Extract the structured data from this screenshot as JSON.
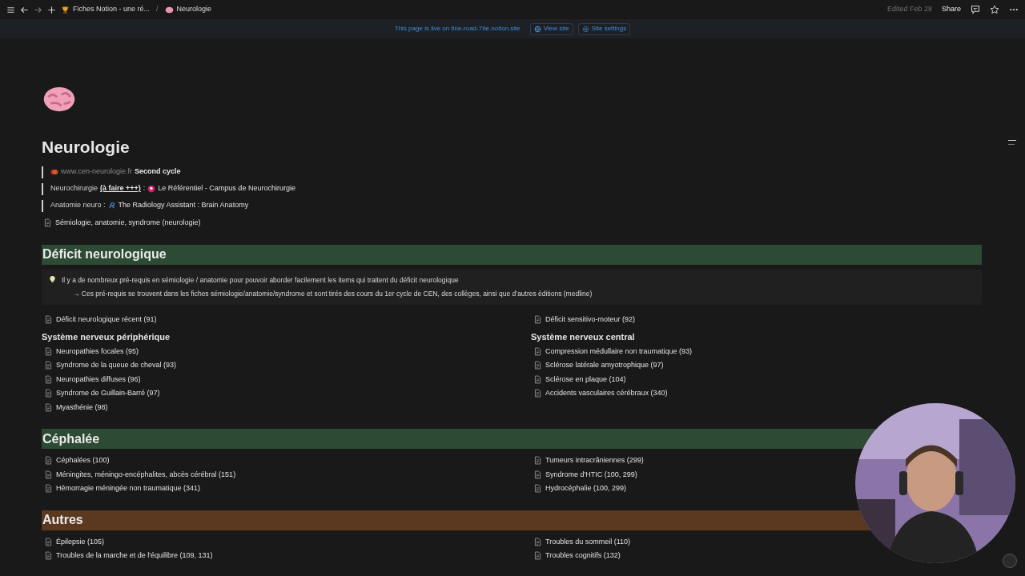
{
  "topbar": {
    "breadcrumbs": [
      {
        "text": "Fiches Notion - une ré..."
      },
      {
        "text": "Neurologie"
      }
    ],
    "separator": "/",
    "edited": "Edited Feb 28",
    "share": "Share"
  },
  "banner": {
    "text": "This page is live on fine-road-79e.notion.site",
    "buttons": [
      {
        "label": "View site"
      },
      {
        "label": "Site settings"
      }
    ]
  },
  "page": {
    "title": "Neurologie",
    "quotes": [
      {
        "parts": [
          {
            "kind": "site-link",
            "text": "www.cen-neurologie.fr"
          },
          {
            "kind": "strong",
            "text": "Second cycle"
          }
        ]
      },
      {
        "parts": [
          {
            "kind": "text",
            "text": "Neurochirurgie"
          },
          {
            "kind": "underline",
            "text": "(à faire +++)"
          },
          {
            "kind": "text",
            "text": ":"
          },
          {
            "kind": "mention",
            "text": "Le Référentiel - Campus de Neurochirurgie"
          }
        ]
      },
      {
        "parts": [
          {
            "kind": "text",
            "text": "Anatomie neuro :"
          },
          {
            "kind": "mention",
            "text": "The Radiology Assistant : Brain Anatomy"
          }
        ]
      }
    ],
    "links": [
      "Sémiologie, anatomie, syndrome (neurologie)"
    ],
    "sections": [
      {
        "title": "Déficit neurologique",
        "color": "#2d4a35",
        "callout": [
          "Il y a de nombreux pré-requis en sémiologie / anatomie pour pouvoir aborder facilement les items qui traitent du déficit neurologique",
          "→ Ces pré-requis se trouvent dans les fiches sémiologie/anatomie/syndrome et sont tirés des cours du 1er cycle de CEN, des collèges, ainsi que d’autres éditions (medline)"
        ],
        "columns": [
          [
            {
              "kind": "page",
              "text": "Déficit neurologique récent (91)"
            },
            {
              "kind": "subheading",
              "text": "Système nerveux périphérique"
            },
            {
              "kind": "page",
              "text": "Neuropathies focales (95)"
            },
            {
              "kind": "page",
              "text": "Syndrome de la queue de cheval (93)"
            },
            {
              "kind": "page",
              "text": "Neuropathies diffuses (96)"
            },
            {
              "kind": "page",
              "text": "Syndrome de Guillain-Barré (97)"
            },
            {
              "kind": "page",
              "text": "Myasthénie (98)"
            }
          ],
          [
            {
              "kind": "page",
              "text": "Déficit sensitivo-moteur (92)"
            },
            {
              "kind": "subheading",
              "text": "Système nerveux central"
            },
            {
              "kind": "page",
              "text": "Compression médullaire non traumatique (93)"
            },
            {
              "kind": "page",
              "text": "Sclérose latérale amyotrophique (97)"
            },
            {
              "kind": "page",
              "text": "Sclérose en plaque (104)"
            },
            {
              "kind": "page",
              "text": "Accidents vasculaires cérébraux (340)"
            }
          ]
        ]
      },
      {
        "title": "Céphalée",
        "color": "#2d4a35",
        "columns": [
          [
            {
              "kind": "page",
              "text": "Céphalées (100)"
            },
            {
              "kind": "page",
              "text": "Méningites, méningo-encéphalites, abcès cérébral (151)"
            },
            {
              "kind": "page",
              "text": "Hémorragie méningée non traumatique (341)"
            }
          ],
          [
            {
              "kind": "page",
              "text": "Tumeurs intracrâniennes (299)"
            },
            {
              "kind": "page",
              "text": "Syndrome d'HTIC (100, 299)"
            },
            {
              "kind": "page",
              "text": "Hydrocéphalie (100, 299)"
            }
          ]
        ]
      },
      {
        "title": "Autres",
        "color": "#5b3920",
        "columns": [
          [
            {
              "kind": "page",
              "text": "Épilepsie (105)"
            },
            {
              "kind": "page",
              "text": "Troubles de la marche et de l'équilibre (109, 131)"
            }
          ],
          [
            {
              "kind": "page",
              "text": "Troubles du sommeil (110)"
            },
            {
              "kind": "page",
              "text": "Troubles cognitifs (132)"
            }
          ]
        ]
      }
    ]
  }
}
